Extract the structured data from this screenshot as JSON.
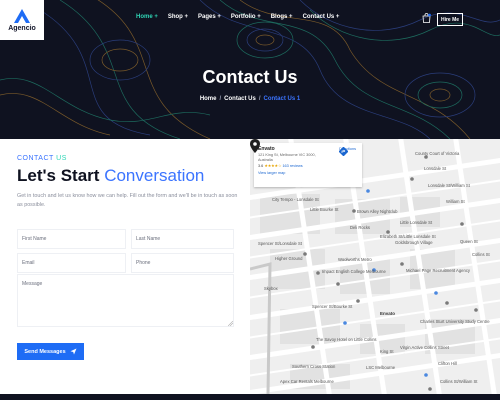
{
  "brand": {
    "name": "Agencio"
  },
  "nav": {
    "items": [
      "Home +",
      "Shop +",
      "Pages +",
      "Portfolio +",
      "Blogs +",
      "Contact Us +"
    ],
    "cta": "Hire Me"
  },
  "hero": {
    "title": "Contact Us",
    "breadcrumb": [
      "Home",
      "Contact Us",
      "Contact Us 1"
    ]
  },
  "form": {
    "eyebrow_a": "CONTACT",
    "eyebrow_b": " US",
    "heading_a": "Let's Start ",
    "heading_b": "Conversation",
    "intro": "Get in touch and let us know how we can help. Fill out the form and we'll be in touch as soon as possible.",
    "placeholders": {
      "first_name": "First Name",
      "last_name": "Last Name",
      "email": "Email",
      "phone": "Phone",
      "message": "Message"
    },
    "submit": "Send Messages"
  },
  "map": {
    "place": "Envato",
    "address": "121 King St, Melbourne VIC 3000, Australia",
    "rating": "3.6",
    "stars": "★★★★☆",
    "reviews": "163 reviews",
    "directions": "Directions",
    "larger": "View larger map",
    "pin_label": "Envato",
    "labels": [
      "County Court of Victoria",
      "Lonsdale St",
      "Lonsdale St/William St",
      "City Tempo - Lonsdale St",
      "Brown Alley Nightclub",
      "Little Bourke St",
      "Little Lonsdale St",
      "Deli Rocks",
      "Elizabeth St/Little Lonsdale St",
      "Spencer St/Lonsdale St",
      "Goldsbrough Village",
      "Higher Ground",
      "Collins St",
      "Woolworths Metro",
      "Impact English College Melbourne",
      "Michael Page Recruitment Agency",
      "Skybox",
      "Spencer St/Bourke St",
      "Charles Sturt University Study Centre",
      "The Savoy Hotel on Little Collins",
      "Virgin Active Collins Street",
      "Southern Cross Station",
      "LSC Melbourne",
      "Apex Car Rentals Melbourne",
      "Clifton Hill",
      "King St",
      "William St",
      "Queen St",
      "Collins St/William St"
    ]
  },
  "colors": {
    "hero_bg": "#0f1220",
    "accent_blue": "#1e6cf5",
    "accent_teal": "#2fd6b6"
  }
}
